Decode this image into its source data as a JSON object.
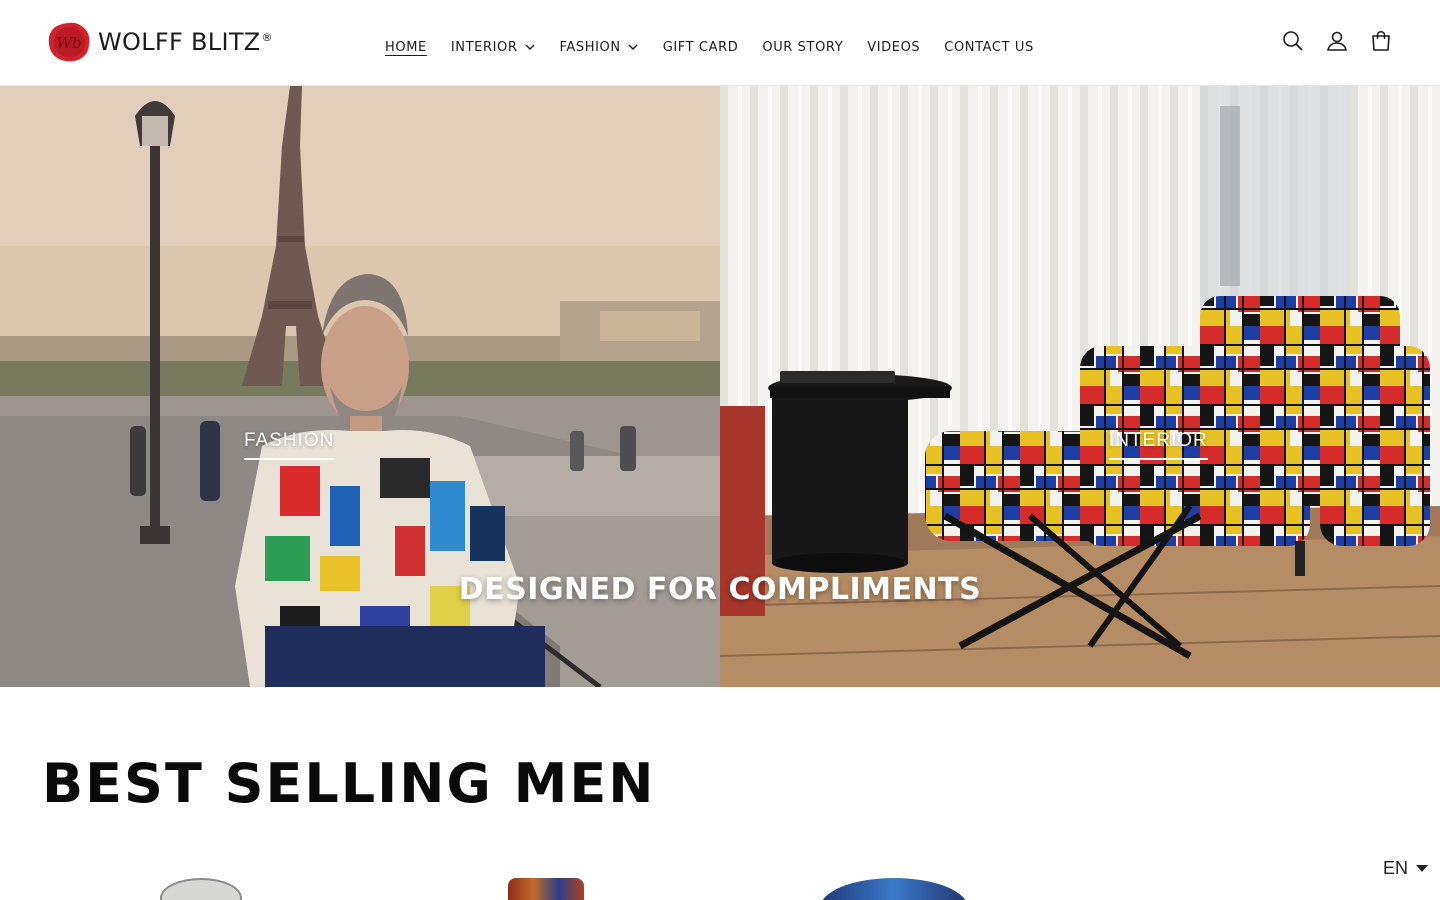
{
  "brand": {
    "name": "WOLFF BLITZ",
    "registered": "®",
    "seal_monogram": "Wb",
    "seal_color": "#d2232a"
  },
  "nav": {
    "items": [
      {
        "label": "HOME",
        "active": true,
        "has_dropdown": false
      },
      {
        "label": "INTERIOR",
        "active": false,
        "has_dropdown": true
      },
      {
        "label": "FASHION",
        "active": false,
        "has_dropdown": true
      },
      {
        "label": "GIFT CARD",
        "active": false,
        "has_dropdown": false
      },
      {
        "label": "OUR STORY",
        "active": false,
        "has_dropdown": false
      },
      {
        "label": "VIDEOS",
        "active": false,
        "has_dropdown": false
      },
      {
        "label": "CONTACT US",
        "active": false,
        "has_dropdown": false
      }
    ]
  },
  "header_icons": [
    "search-icon",
    "account-icon",
    "cart-icon"
  ],
  "hero": {
    "left_link": "FASHION",
    "right_link": "INTERIOR",
    "tagline": "DESIGNED FOR COMPLIMENTS"
  },
  "section": {
    "title": "BEST SELLING MEN"
  },
  "language": {
    "current": "EN"
  },
  "colors": {
    "accent": "#d2232a",
    "text": "#121212",
    "background": "#ffffff"
  }
}
